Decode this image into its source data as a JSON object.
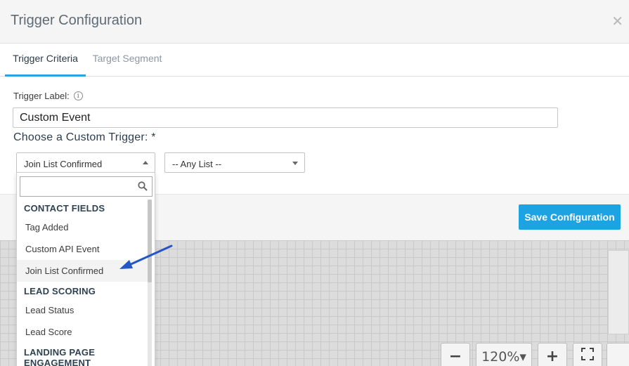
{
  "modal": {
    "title": "Trigger Configuration",
    "close_icon": "close-icon"
  },
  "tabs": [
    {
      "label": "Trigger Criteria",
      "active": true
    },
    {
      "label": "Target Segment",
      "active": false
    }
  ],
  "form": {
    "trigger_label": "Trigger Label:",
    "trigger_label_value": "Custom Event",
    "choose_label": "Choose a Custom Trigger: *",
    "trigger_select_value": "Join List Confirmed",
    "list_select_value": "-- Any List --"
  },
  "footer": {
    "save_label": "Save Configuration"
  },
  "dropdown": {
    "search_placeholder": "",
    "groups": [
      {
        "label": "CONTACT FIELDS",
        "items": [
          "Tag Added",
          "Custom API Event",
          "Join List Confirmed"
        ]
      },
      {
        "label": "LEAD SCORING",
        "items": [
          "Lead Status",
          "Lead Score"
        ]
      },
      {
        "label": "LANDING PAGE ENGAGEMENT",
        "items": []
      }
    ],
    "selected_item": "Join List Confirmed"
  },
  "canvas": {
    "zoom_level": "120%▾"
  },
  "colors": {
    "accent": "#1ba3e4",
    "tab_underline": "#29a4e3",
    "arrow": "#2456c8"
  }
}
